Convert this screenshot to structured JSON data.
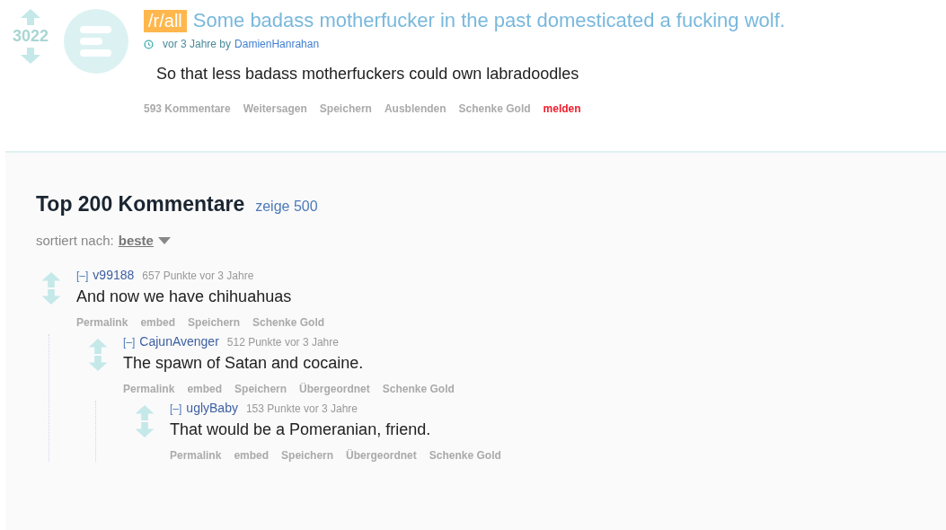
{
  "post": {
    "score": "3022",
    "tag": "/r/all",
    "title": "Some badass motherfucker in the past domesticated a fucking wolf.",
    "time": "vor 3 Jahre by",
    "author": "DamienHanrahan",
    "body": "So that less badass motherfuckers could own labradoodles",
    "actions": [
      {
        "label": "593 Kommentare",
        "kind": "link"
      },
      {
        "label": "Weitersagen",
        "kind": "link"
      },
      {
        "label": "Speichern",
        "kind": "link"
      },
      {
        "label": "Ausblenden",
        "kind": "link"
      },
      {
        "label": "Schenke Gold",
        "kind": "link"
      },
      {
        "label": "melden",
        "kind": "report"
      }
    ]
  },
  "comments_header": {
    "title": "Top 200 Kommentare",
    "show_more": "zeige 500",
    "sort_label": "sortiert nach:",
    "sort_value": "beste"
  },
  "comments": [
    {
      "collapse": "[–]",
      "author": "v99188",
      "meta": "657 Punkte vor 3 Jahre",
      "body": "And now we have chihuahuas",
      "actions": [
        "Permalink",
        "embed",
        "Speichern",
        "Schenke Gold"
      ],
      "children": [
        {
          "collapse": "[–]",
          "author": "CajunAvenger",
          "meta": "512 Punkte vor 3 Jahre",
          "body": "The spawn of Satan and cocaine.",
          "actions": [
            "Permalink",
            "embed",
            "Speichern",
            "Übergeordnet",
            "Schenke Gold"
          ],
          "children": [
            {
              "collapse": "[–]",
              "author": "uglyBaby",
              "meta": "153 Punkte vor 3 Jahre",
              "body": "That would be a Pomeranian, friend.",
              "actions": [
                "Permalink",
                "embed",
                "Speichern",
                "Übergeordnet",
                "Schenke Gold"
              ]
            }
          ]
        }
      ]
    }
  ]
}
